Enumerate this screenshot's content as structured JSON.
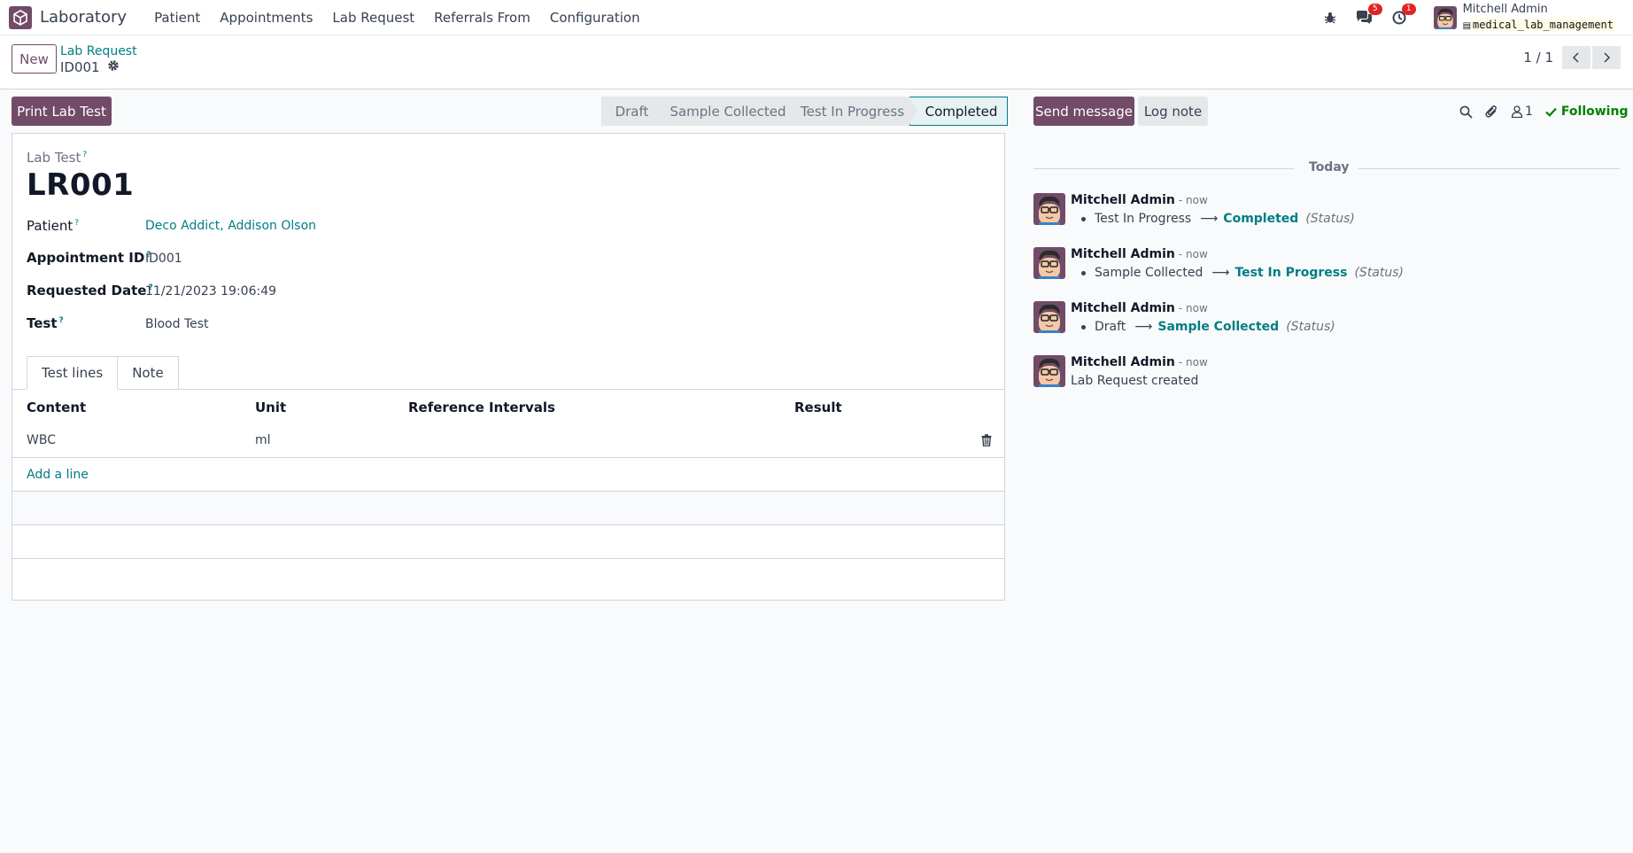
{
  "navbar": {
    "app_name": "Laboratory",
    "menu": [
      "Patient",
      "Appointments",
      "Lab Request",
      "Referrals From",
      "Configuration"
    ],
    "messages_badge": "5",
    "activities_badge": "1",
    "user_name": "Mitchell Admin",
    "database": "medical_lab_management"
  },
  "control_panel": {
    "new_label": "New",
    "breadcrumb": "Lab Request",
    "record_name": "ID001",
    "pager": "1 / 1"
  },
  "form": {
    "print_button": "Print Lab Test",
    "stages": [
      "Draft",
      "Sample Collected",
      "Test In Progress",
      "Completed"
    ],
    "current_stage": "Completed",
    "title_label": "Lab Test",
    "title_help": "?",
    "title": "LR001",
    "fields": [
      {
        "label": "Patient",
        "help": "?",
        "value": "Deco Addict, Addison Olson"
      },
      {
        "label": "Appointment ID",
        "help": "?",
        "value": "ID001"
      },
      {
        "label": "Requested Date",
        "help": "?",
        "value": "11/21/2023 19:06:49"
      },
      {
        "label": "Test",
        "help": "?",
        "value": "Blood Test"
      }
    ],
    "tabs": [
      "Test lines",
      "Note"
    ],
    "active_tab": "Test lines",
    "table": {
      "columns": [
        "Content",
        "Unit",
        "Reference Intervals",
        "Result"
      ],
      "rows": [
        {
          "content": "WBC",
          "unit": "ml",
          "reference": "",
          "result": ""
        }
      ],
      "add_line": "Add a line"
    }
  },
  "chatter": {
    "send_message": "Send message",
    "log_note": "Log note",
    "followers_count": "1",
    "following_label": "Following",
    "day_label": "Today",
    "messages": [
      {
        "author": "Mitchell Admin",
        "time": "- now",
        "old": "Test In Progress",
        "new": "Completed",
        "field": "(Status)"
      },
      {
        "author": "Mitchell Admin",
        "time": "- now",
        "old": "Sample Collected",
        "new": "Test In Progress",
        "field": "(Status)"
      },
      {
        "author": "Mitchell Admin",
        "time": "- now",
        "old": "Draft",
        "new": "Sample Collected",
        "field": "(Status)"
      },
      {
        "author": "Mitchell Admin",
        "time": "- now",
        "text": "Lab Request created"
      }
    ]
  },
  "colors": {
    "brand": "#714b67",
    "link": "#017e84",
    "badge": "#e02424",
    "following": "#008000"
  }
}
